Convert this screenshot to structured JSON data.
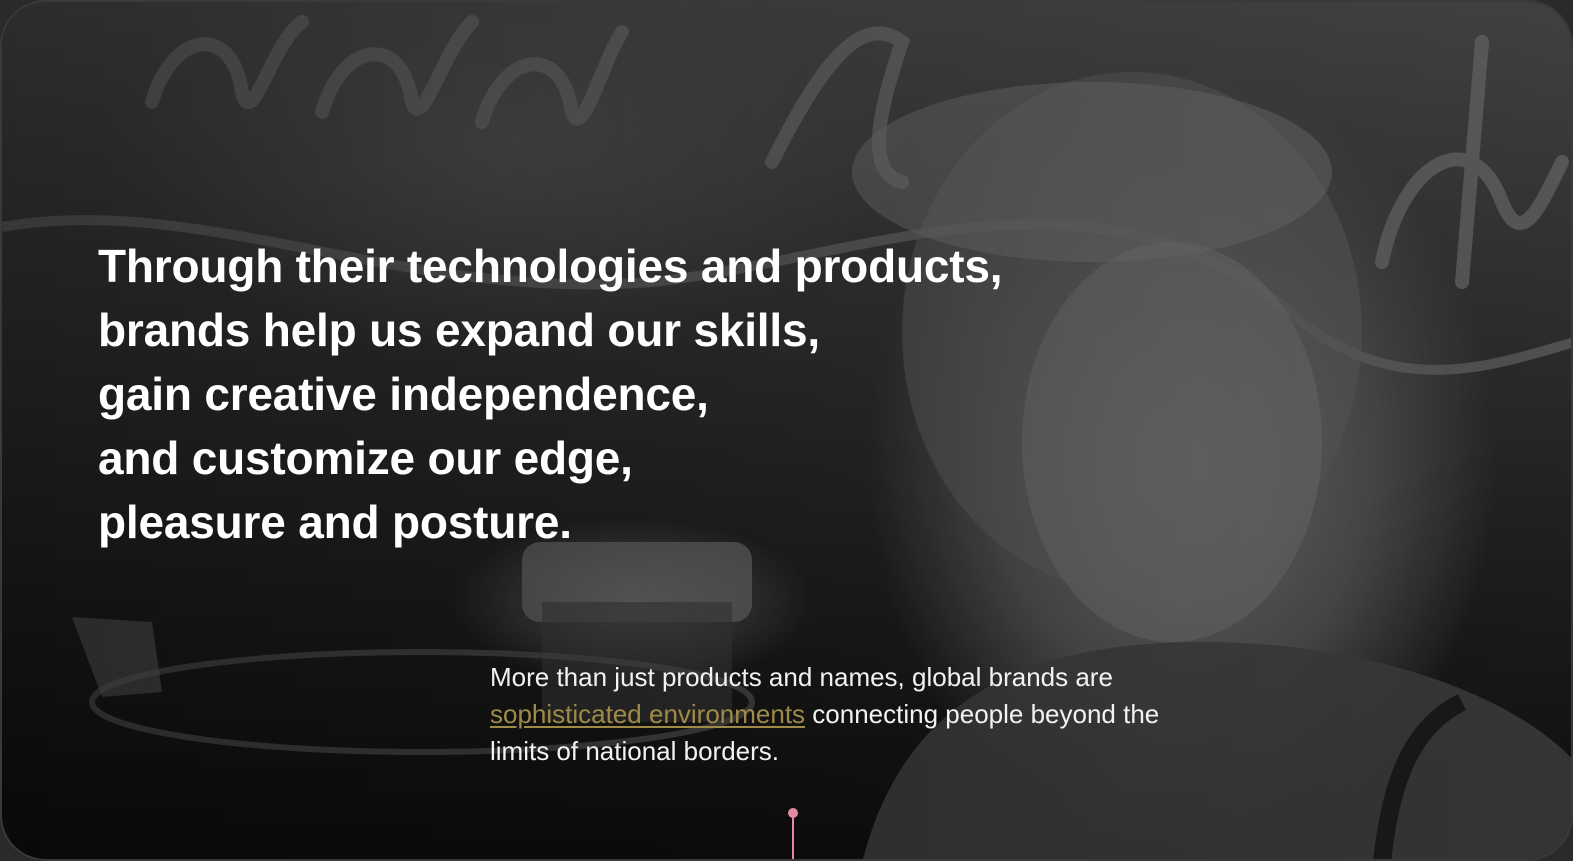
{
  "hero": {
    "headline_lines": [
      "Through their technologies and products,",
      "brands help us expand our skills,",
      "gain creative independence,",
      "and customize our edge,",
      "pleasure and posture."
    ],
    "body_before_link": "More than just products and names, global brands are ",
    "body_link": "sophisticated environments",
    "body_after_link": " connecting people beyond the limits of national borders.",
    "link_color": "#a08a47",
    "indicator_color": "#e48aa4"
  }
}
